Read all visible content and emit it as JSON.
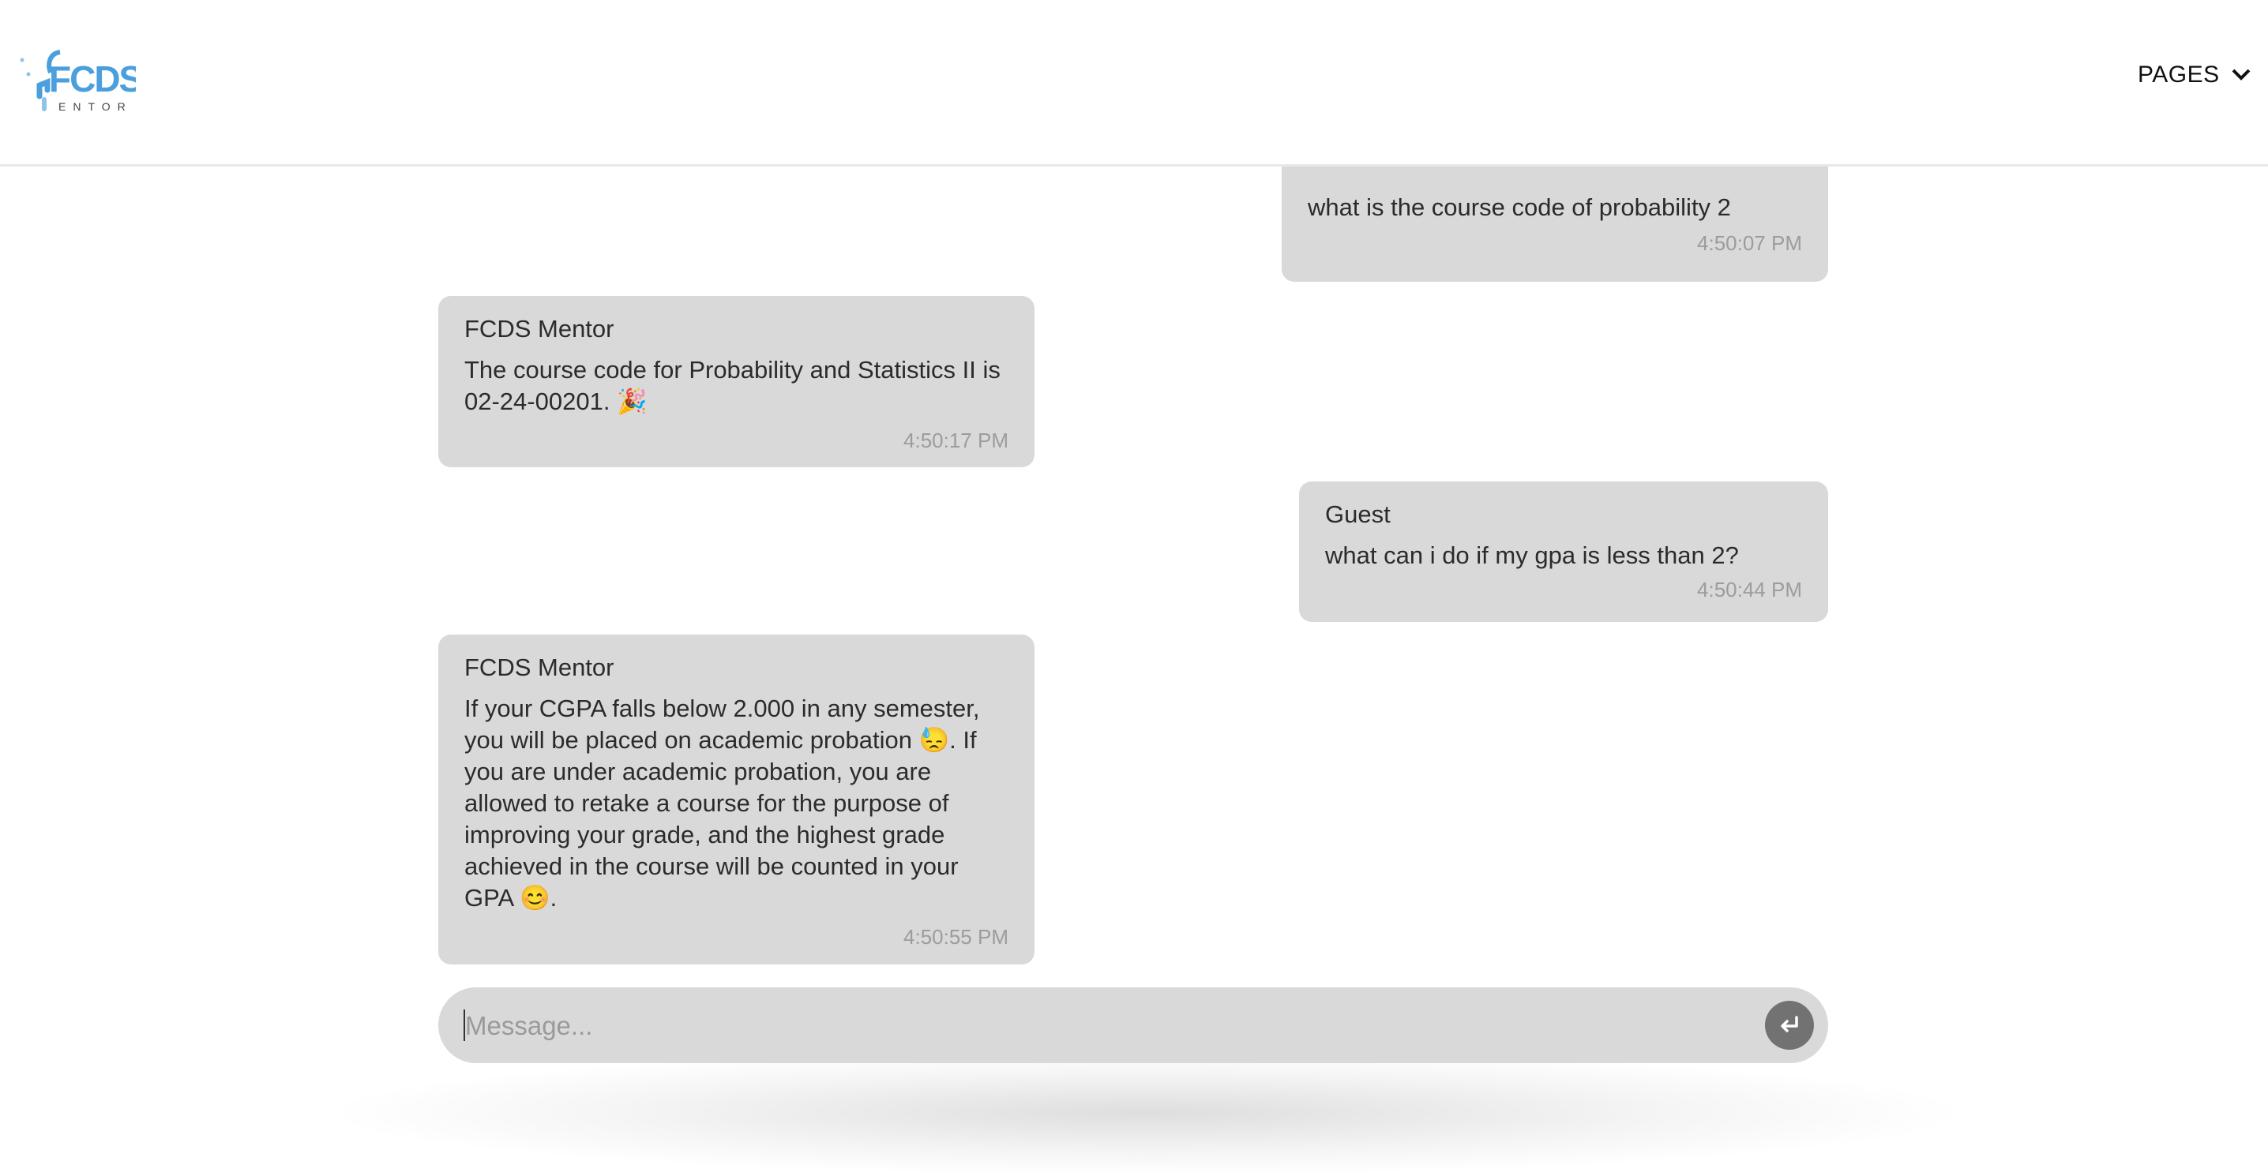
{
  "header": {
    "logo_text": "FCDS MENTOR",
    "pages_label": "PAGES",
    "brand_color": "#4a9fdc"
  },
  "messages": [
    {
      "sender": "",
      "role": "user",
      "text": "what is the course code of probability 2",
      "time": "4:50:07 PM"
    },
    {
      "sender": "FCDS Mentor",
      "role": "bot",
      "text": "The course code for Probability and Statistics II is 02-24-00201. 🎉",
      "time": "4:50:17 PM"
    },
    {
      "sender": "Guest",
      "role": "user",
      "text": "what can i do if my gpa is less than 2?",
      "time": "4:50:44 PM"
    },
    {
      "sender": "FCDS Mentor",
      "role": "bot",
      "text": "If your CGPA falls below 2.000 in any semester, you will be placed on academic probation 😓. If you are under academic probation, you are allowed to retake a course for the purpose of improving your grade, and the highest grade achieved in the course will be counted in your GPA 😊.",
      "time": "4:50:55 PM"
    }
  ],
  "composer": {
    "placeholder": "Message...",
    "value": "",
    "send_icon": "enter-return-icon"
  }
}
